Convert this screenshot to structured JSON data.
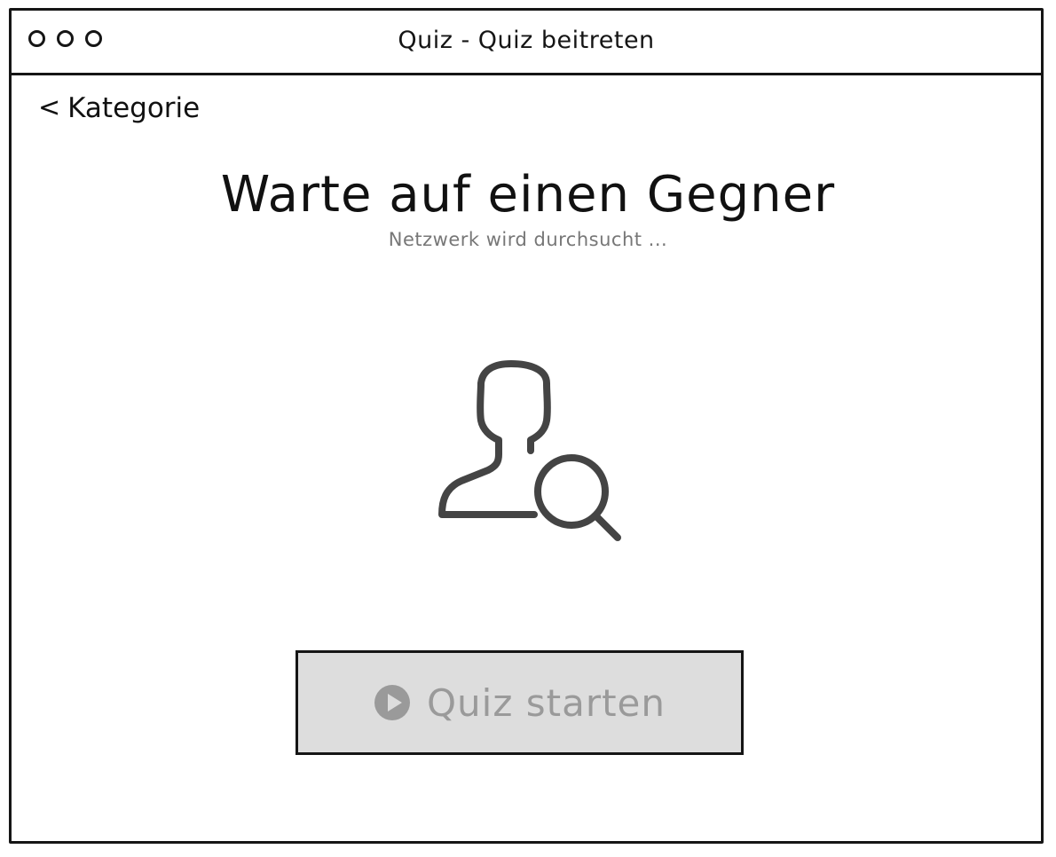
{
  "window": {
    "title": "Quiz - Quiz beitreten"
  },
  "nav": {
    "back_chevron": "<",
    "back_label": "Kategorie"
  },
  "main": {
    "heading": "Warte auf einen Gegner",
    "subheading": "Netzwerk wird durchsucht ...",
    "illustration_icon": "user-search-icon"
  },
  "actions": {
    "start_label": "Quiz starten",
    "start_icon": "play-circle-icon",
    "start_disabled": true
  },
  "colors": {
    "ink": "#151515",
    "icon": "#444444",
    "disabled_bg": "#dddddd",
    "disabled_text": "#9a9a9a",
    "muted_text": "#777777"
  }
}
